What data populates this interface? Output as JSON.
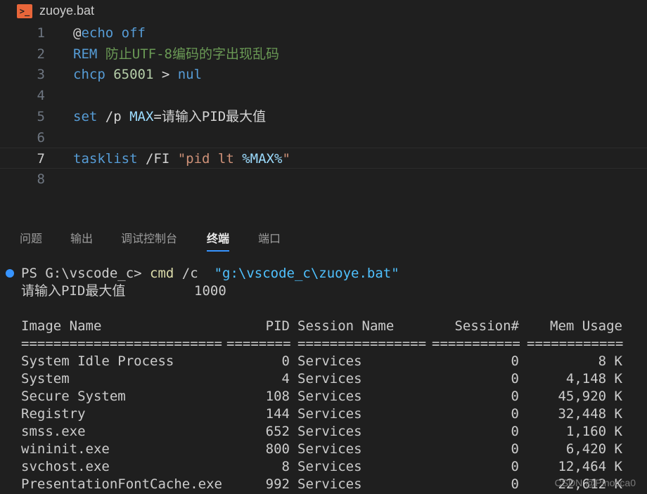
{
  "file": {
    "name": "zuoye.bat",
    "icon": "terminal-file-icon"
  },
  "code_lines": [
    {
      "n": "1",
      "parts": [
        {
          "t": "@",
          "c": "pl"
        },
        {
          "t": "echo off",
          "c": "kw"
        }
      ]
    },
    {
      "n": "2",
      "parts": [
        {
          "t": "REM ",
          "c": "kw"
        },
        {
          "t": "防止UTF-8编码的字出现乱码",
          "c": "cm"
        }
      ]
    },
    {
      "n": "3",
      "parts": [
        {
          "t": "chcp ",
          "c": "kw"
        },
        {
          "t": "65001",
          "c": "num"
        },
        {
          "t": " > ",
          "c": "pl"
        },
        {
          "t": "nul",
          "c": "kw"
        }
      ]
    },
    {
      "n": "4",
      "parts": []
    },
    {
      "n": "5",
      "parts": [
        {
          "t": "set",
          "c": "kw"
        },
        {
          "t": " /p ",
          "c": "pl"
        },
        {
          "t": "MAX",
          "c": "var"
        },
        {
          "t": "=请输入PID最大值",
          "c": "pl"
        }
      ]
    },
    {
      "n": "6",
      "parts": []
    },
    {
      "n": "7",
      "parts": [
        {
          "t": "tasklist",
          "c": "kw"
        },
        {
          "t": " /FI ",
          "c": "pl"
        },
        {
          "t": "\"pid lt ",
          "c": "str"
        },
        {
          "t": "%MAX%",
          "c": "var"
        },
        {
          "t": "\"",
          "c": "str"
        }
      ]
    },
    {
      "n": "8",
      "parts": []
    }
  ],
  "active_line": "7",
  "panel_tabs": [
    "问题",
    "输出",
    "调试控制台",
    "终端",
    "端口"
  ],
  "active_panel_tab": "终端",
  "terminal": {
    "prompt": "PS G:\\vscode_c> ",
    "cmd": "cmd",
    "args": " /c  ",
    "path": "\"g:\\vscode_c\\zuoye.bat\"",
    "input_label": "请输入PID最大值",
    "input_value": "1000",
    "headers": [
      "Image Name",
      "PID",
      "Session Name",
      "Session#",
      "Mem Usage"
    ],
    "separators": [
      "=========================",
      "========",
      "================",
      "===========",
      "============"
    ],
    "rows": [
      [
        "System Idle Process",
        "0",
        "Services",
        "0",
        "8 K"
      ],
      [
        "System",
        "4",
        "Services",
        "0",
        "4,148 K"
      ],
      [
        "Secure System",
        "108",
        "Services",
        "0",
        "45,920 K"
      ],
      [
        "Registry",
        "144",
        "Services",
        "0",
        "32,448 K"
      ],
      [
        "smss.exe",
        "652",
        "Services",
        "0",
        "1,160 K"
      ],
      [
        "wininit.exe",
        "800",
        "Services",
        "0",
        "6,420 K"
      ],
      [
        "svchost.exe",
        "8",
        "Services",
        "0",
        "12,464 K"
      ],
      [
        "PresentationFontCache.exe",
        "992",
        "Services",
        "0",
        "22,612 K"
      ]
    ]
  },
  "watermark": "CSDN @Pinocca0"
}
